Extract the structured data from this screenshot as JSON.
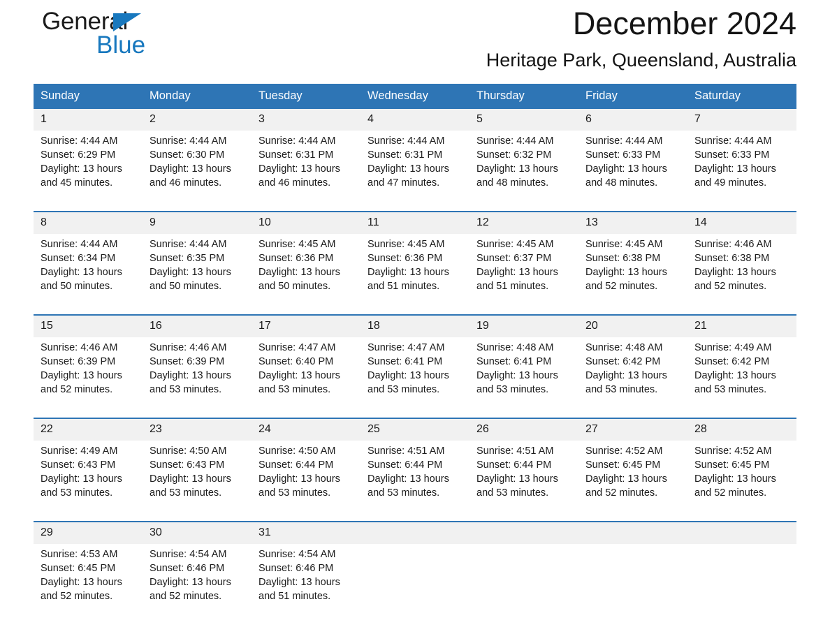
{
  "brand": {
    "name_part1": "General",
    "name_part2": "Blue",
    "accent_color": "#1878be",
    "triangle_icon": "triangle-icon"
  },
  "header": {
    "month_title": "December 2024",
    "location": "Heritage Park, Queensland, Australia"
  },
  "calendar": {
    "header_background": "#2e75b5",
    "daynum_background": "#f1f1f1",
    "weekdays": [
      "Sunday",
      "Monday",
      "Tuesday",
      "Wednesday",
      "Thursday",
      "Friday",
      "Saturday"
    ],
    "weeks": [
      [
        {
          "day": "1",
          "sunrise": "Sunrise: 4:44 AM",
          "sunset": "Sunset: 6:29 PM",
          "daylight_line1": "Daylight: 13 hours",
          "daylight_line2": "and 45 minutes."
        },
        {
          "day": "2",
          "sunrise": "Sunrise: 4:44 AM",
          "sunset": "Sunset: 6:30 PM",
          "daylight_line1": "Daylight: 13 hours",
          "daylight_line2": "and 46 minutes."
        },
        {
          "day": "3",
          "sunrise": "Sunrise: 4:44 AM",
          "sunset": "Sunset: 6:31 PM",
          "daylight_line1": "Daylight: 13 hours",
          "daylight_line2": "and 46 minutes."
        },
        {
          "day": "4",
          "sunrise": "Sunrise: 4:44 AM",
          "sunset": "Sunset: 6:31 PM",
          "daylight_line1": "Daylight: 13 hours",
          "daylight_line2": "and 47 minutes."
        },
        {
          "day": "5",
          "sunrise": "Sunrise: 4:44 AM",
          "sunset": "Sunset: 6:32 PM",
          "daylight_line1": "Daylight: 13 hours",
          "daylight_line2": "and 48 minutes."
        },
        {
          "day": "6",
          "sunrise": "Sunrise: 4:44 AM",
          "sunset": "Sunset: 6:33 PM",
          "daylight_line1": "Daylight: 13 hours",
          "daylight_line2": "and 48 minutes."
        },
        {
          "day": "7",
          "sunrise": "Sunrise: 4:44 AM",
          "sunset": "Sunset: 6:33 PM",
          "daylight_line1": "Daylight: 13 hours",
          "daylight_line2": "and 49 minutes."
        }
      ],
      [
        {
          "day": "8",
          "sunrise": "Sunrise: 4:44 AM",
          "sunset": "Sunset: 6:34 PM",
          "daylight_line1": "Daylight: 13 hours",
          "daylight_line2": "and 50 minutes."
        },
        {
          "day": "9",
          "sunrise": "Sunrise: 4:44 AM",
          "sunset": "Sunset: 6:35 PM",
          "daylight_line1": "Daylight: 13 hours",
          "daylight_line2": "and 50 minutes."
        },
        {
          "day": "10",
          "sunrise": "Sunrise: 4:45 AM",
          "sunset": "Sunset: 6:36 PM",
          "daylight_line1": "Daylight: 13 hours",
          "daylight_line2": "and 50 minutes."
        },
        {
          "day": "11",
          "sunrise": "Sunrise: 4:45 AM",
          "sunset": "Sunset: 6:36 PM",
          "daylight_line1": "Daylight: 13 hours",
          "daylight_line2": "and 51 minutes."
        },
        {
          "day": "12",
          "sunrise": "Sunrise: 4:45 AM",
          "sunset": "Sunset: 6:37 PM",
          "daylight_line1": "Daylight: 13 hours",
          "daylight_line2": "and 51 minutes."
        },
        {
          "day": "13",
          "sunrise": "Sunrise: 4:45 AM",
          "sunset": "Sunset: 6:38 PM",
          "daylight_line1": "Daylight: 13 hours",
          "daylight_line2": "and 52 minutes."
        },
        {
          "day": "14",
          "sunrise": "Sunrise: 4:46 AM",
          "sunset": "Sunset: 6:38 PM",
          "daylight_line1": "Daylight: 13 hours",
          "daylight_line2": "and 52 minutes."
        }
      ],
      [
        {
          "day": "15",
          "sunrise": "Sunrise: 4:46 AM",
          "sunset": "Sunset: 6:39 PM",
          "daylight_line1": "Daylight: 13 hours",
          "daylight_line2": "and 52 minutes."
        },
        {
          "day": "16",
          "sunrise": "Sunrise: 4:46 AM",
          "sunset": "Sunset: 6:39 PM",
          "daylight_line1": "Daylight: 13 hours",
          "daylight_line2": "and 53 minutes."
        },
        {
          "day": "17",
          "sunrise": "Sunrise: 4:47 AM",
          "sunset": "Sunset: 6:40 PM",
          "daylight_line1": "Daylight: 13 hours",
          "daylight_line2": "and 53 minutes."
        },
        {
          "day": "18",
          "sunrise": "Sunrise: 4:47 AM",
          "sunset": "Sunset: 6:41 PM",
          "daylight_line1": "Daylight: 13 hours",
          "daylight_line2": "and 53 minutes."
        },
        {
          "day": "19",
          "sunrise": "Sunrise: 4:48 AM",
          "sunset": "Sunset: 6:41 PM",
          "daylight_line1": "Daylight: 13 hours",
          "daylight_line2": "and 53 minutes."
        },
        {
          "day": "20",
          "sunrise": "Sunrise: 4:48 AM",
          "sunset": "Sunset: 6:42 PM",
          "daylight_line1": "Daylight: 13 hours",
          "daylight_line2": "and 53 minutes."
        },
        {
          "day": "21",
          "sunrise": "Sunrise: 4:49 AM",
          "sunset": "Sunset: 6:42 PM",
          "daylight_line1": "Daylight: 13 hours",
          "daylight_line2": "and 53 minutes."
        }
      ],
      [
        {
          "day": "22",
          "sunrise": "Sunrise: 4:49 AM",
          "sunset": "Sunset: 6:43 PM",
          "daylight_line1": "Daylight: 13 hours",
          "daylight_line2": "and 53 minutes."
        },
        {
          "day": "23",
          "sunrise": "Sunrise: 4:50 AM",
          "sunset": "Sunset: 6:43 PM",
          "daylight_line1": "Daylight: 13 hours",
          "daylight_line2": "and 53 minutes."
        },
        {
          "day": "24",
          "sunrise": "Sunrise: 4:50 AM",
          "sunset": "Sunset: 6:44 PM",
          "daylight_line1": "Daylight: 13 hours",
          "daylight_line2": "and 53 minutes."
        },
        {
          "day": "25",
          "sunrise": "Sunrise: 4:51 AM",
          "sunset": "Sunset: 6:44 PM",
          "daylight_line1": "Daylight: 13 hours",
          "daylight_line2": "and 53 minutes."
        },
        {
          "day": "26",
          "sunrise": "Sunrise: 4:51 AM",
          "sunset": "Sunset: 6:44 PM",
          "daylight_line1": "Daylight: 13 hours",
          "daylight_line2": "and 53 minutes."
        },
        {
          "day": "27",
          "sunrise": "Sunrise: 4:52 AM",
          "sunset": "Sunset: 6:45 PM",
          "daylight_line1": "Daylight: 13 hours",
          "daylight_line2": "and 52 minutes."
        },
        {
          "day": "28",
          "sunrise": "Sunrise: 4:52 AM",
          "sunset": "Sunset: 6:45 PM",
          "daylight_line1": "Daylight: 13 hours",
          "daylight_line2": "and 52 minutes."
        }
      ],
      [
        {
          "day": "29",
          "sunrise": "Sunrise: 4:53 AM",
          "sunset": "Sunset: 6:45 PM",
          "daylight_line1": "Daylight: 13 hours",
          "daylight_line2": "and 52 minutes."
        },
        {
          "day": "30",
          "sunrise": "Sunrise: 4:54 AM",
          "sunset": "Sunset: 6:46 PM",
          "daylight_line1": "Daylight: 13 hours",
          "daylight_line2": "and 52 minutes."
        },
        {
          "day": "31",
          "sunrise": "Sunrise: 4:54 AM",
          "sunset": "Sunset: 6:46 PM",
          "daylight_line1": "Daylight: 13 hours",
          "daylight_line2": "and 51 minutes."
        },
        {
          "day": "",
          "sunrise": "",
          "sunset": "",
          "daylight_line1": "",
          "daylight_line2": ""
        },
        {
          "day": "",
          "sunrise": "",
          "sunset": "",
          "daylight_line1": "",
          "daylight_line2": ""
        },
        {
          "day": "",
          "sunrise": "",
          "sunset": "",
          "daylight_line1": "",
          "daylight_line2": ""
        },
        {
          "day": "",
          "sunrise": "",
          "sunset": "",
          "daylight_line1": "",
          "daylight_line2": ""
        }
      ]
    ]
  }
}
